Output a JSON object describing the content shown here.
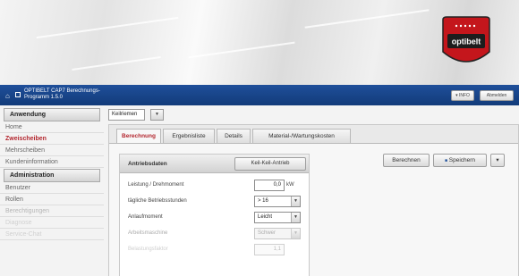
{
  "header": {
    "app_title_line1": "OPTIBELT CAP7 Berechnungs-",
    "app_title_line2": "Programm 1.5.0",
    "logo_text": "optibelt",
    "info_button": "▾ INFO",
    "logout_button": "Abmelden"
  },
  "sidebar": {
    "sections": [
      {
        "title": "Anwendung",
        "items": [
          {
            "label": "Home",
            "state": "normal"
          },
          {
            "label": "Zweischeiben",
            "state": "active"
          },
          {
            "label": "Mehrscheiben",
            "state": "normal"
          },
          {
            "label": "Kundeninformation",
            "state": "normal"
          }
        ]
      },
      {
        "title": "Administration",
        "items": [
          {
            "label": "Benutzer",
            "state": "normal"
          },
          {
            "label": "Rollen",
            "state": "normal"
          },
          {
            "label": "Berechtigungen",
            "state": "faded"
          },
          {
            "label": "Diagnose",
            "state": "faded2"
          },
          {
            "label": "Service-Chat",
            "state": "faded2"
          }
        ]
      }
    ]
  },
  "toolbar": {
    "belt_type": "Keilriemen"
  },
  "tabs": [
    {
      "label": "Berechnung",
      "active": true
    },
    {
      "label": "Ergebnisliste",
      "active": false
    },
    {
      "label": "Details",
      "active": false
    },
    {
      "label": "Material-/Wartungskosten",
      "active": false
    }
  ],
  "panel": {
    "title": "Antriebsdaten",
    "drive_button": "Keil-Keil-Antrieb",
    "fields": [
      {
        "label": "Leistung / Drehmoment",
        "value": "0,0",
        "unit": "kW"
      },
      {
        "label": "tägliche Betriebsstunden",
        "value": "> 16"
      },
      {
        "label": "Anlaufmoment",
        "value": "Leicht"
      },
      {
        "label": "Arbeitsmaschine",
        "value": "Schwer"
      },
      {
        "label": "Belastungsfaktor",
        "value": "1,1"
      }
    ]
  },
  "actions": {
    "calculate": "Berechnen",
    "save": "Speichern",
    "save_icon": "■",
    "more": "▾"
  }
}
